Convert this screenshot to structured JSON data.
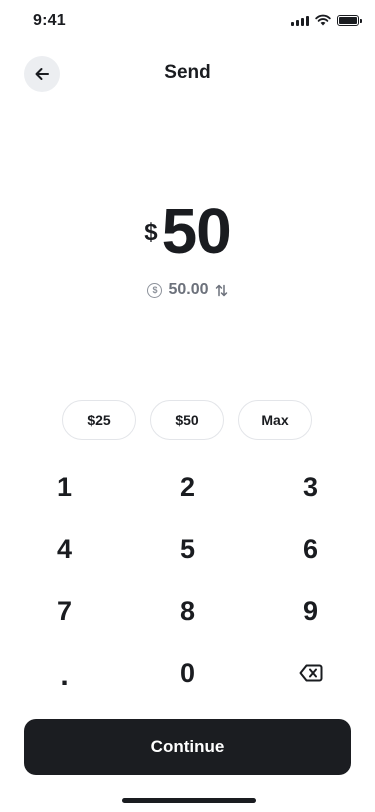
{
  "status_bar": {
    "time": "9:41",
    "icons": [
      "signal-icon",
      "wifi-icon",
      "battery-icon"
    ]
  },
  "header": {
    "back_icon": "arrow-left-icon",
    "title": "Send"
  },
  "amount": {
    "currency_symbol": "$",
    "value": "50",
    "secondary_icon": "dollar-coin-icon",
    "secondary_icon_glyph": "$",
    "secondary_value": "50.00",
    "swap_icon": "swap-vertical-icon"
  },
  "quick_amounts": [
    "$25",
    "$50",
    "Max"
  ],
  "keypad": {
    "keys": [
      "1",
      "2",
      "3",
      "4",
      "5",
      "6",
      "7",
      "8",
      "9",
      ".",
      "0"
    ],
    "backspace_icon": "backspace-icon"
  },
  "continue_label": "Continue",
  "colors": {
    "text": "#1a1c20",
    "muted": "#6c717b",
    "button_bg": "#1b1d21",
    "button_text": "#ffffff",
    "back_bg": "#eceef1",
    "chip_border": "#e3e5e9"
  }
}
